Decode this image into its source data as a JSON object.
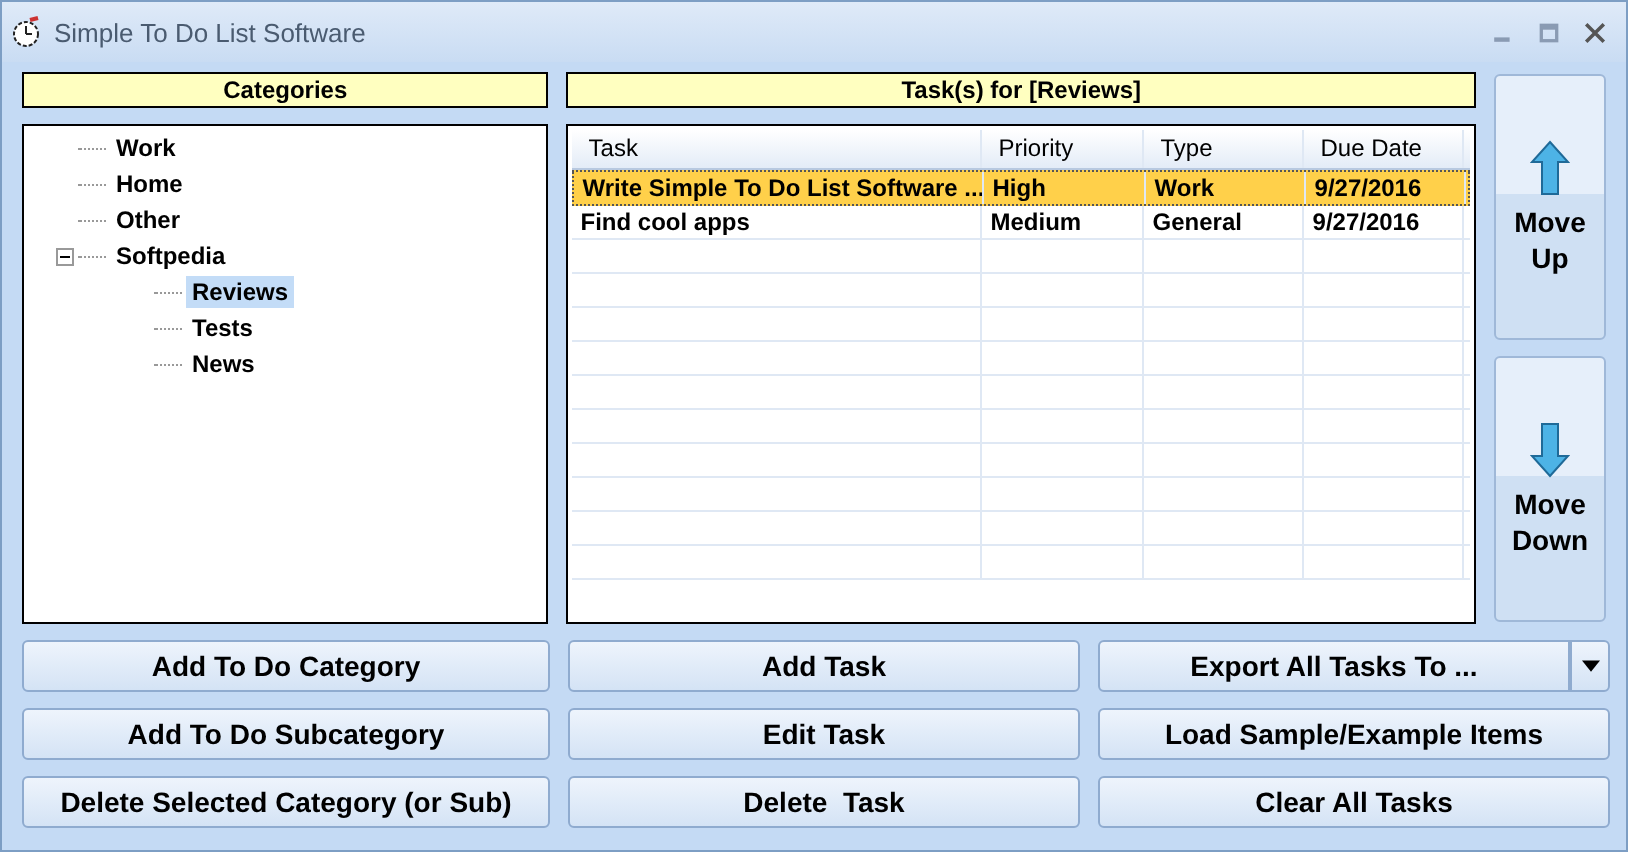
{
  "window": {
    "title": "Simple To Do List Software"
  },
  "categories": {
    "header": "Categories",
    "tree": [
      {
        "label": "Work",
        "selected": false
      },
      {
        "label": "Home",
        "selected": false
      },
      {
        "label": "Other",
        "selected": false
      },
      {
        "label": "Softpedia",
        "selected": false,
        "expanded": true,
        "children": [
          {
            "label": "Reviews",
            "selected": true
          },
          {
            "label": "Tests",
            "selected": false
          },
          {
            "label": "News",
            "selected": false
          }
        ]
      }
    ]
  },
  "tasks": {
    "header": "Task(s) for [Reviews]",
    "columns": [
      "Task",
      "Priority",
      "Type",
      "Due Date"
    ],
    "rows": [
      {
        "cells": [
          "Write Simple To Do List Software ...",
          "High",
          "Work",
          "9/27/2016"
        ],
        "selected": true
      },
      {
        "cells": [
          "Find cool apps",
          "Medium",
          "General",
          "9/27/2016"
        ],
        "selected": false
      }
    ]
  },
  "side_buttons": [
    {
      "label": "Move Up",
      "kind": "up"
    },
    {
      "label": "Move Down",
      "kind": "down"
    }
  ],
  "buttons": [
    {
      "label": "Add To Do Category",
      "kind": "plain"
    },
    {
      "label": "Add Task",
      "kind": "plain"
    },
    {
      "label": "Export All Tasks To ...",
      "kind": "dropdown"
    },
    {
      "label": "Add To Do Subcategory",
      "kind": "plain"
    },
    {
      "label": "Edit Task",
      "kind": "plain"
    },
    {
      "label": "Load Sample/Example Items",
      "kind": "plain"
    },
    {
      "label": "Delete Selected Category (or Sub)",
      "kind": "plain"
    },
    {
      "label": "Delete  Task",
      "kind": "plain"
    },
    {
      "label": "Clear All Tasks",
      "kind": "plain"
    }
  ]
}
